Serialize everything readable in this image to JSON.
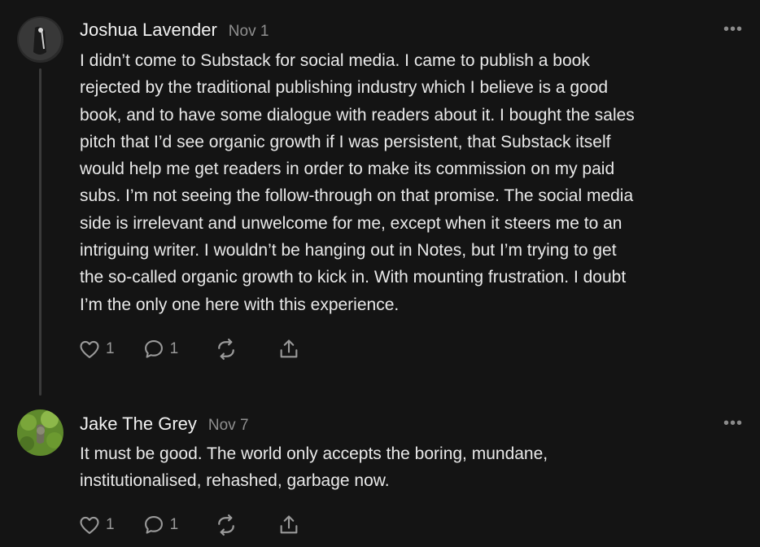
{
  "comments": [
    {
      "author": "Joshua Lavender",
      "date": "Nov 1",
      "lines": [
        "I didn’t come to Substack for social media. I came to publish a book",
        "rejected by the traditional publishing industry which I believe is a good",
        "book, and to have some dialogue with readers about it. I bought the sales",
        "pitch that I’d see organic growth if I was persistent, that Substack itself",
        "would help me get readers in order to make its commission on my paid",
        "subs. I’m not seeing the follow-through on that promise. The social media",
        "side is irrelevant and unwelcome for me, except when it steers me to an",
        "intriguing writer. I wouldn’t be hanging out in Notes, but I’m trying to get",
        "the so-called organic growth to kick in. With mounting frustration. I doubt",
        "I’m the only one here with this experience."
      ],
      "likes": "1",
      "replies": "1",
      "more_icon": "ellipsis-icon"
    },
    {
      "author": "Jake The Grey",
      "date": "Nov 7",
      "lines": [
        "It must be good. The world only accepts the boring, mundane,",
        "institutionalised, rehashed, garbage now."
      ],
      "likes": "1",
      "replies": "1",
      "more_icon": "ellipsis-icon"
    }
  ],
  "more_label": "•••",
  "colors": {
    "background": "#141414",
    "text": "#e9e9e9",
    "muted": "#8f8f8f",
    "icon": "#9a9a9a"
  }
}
